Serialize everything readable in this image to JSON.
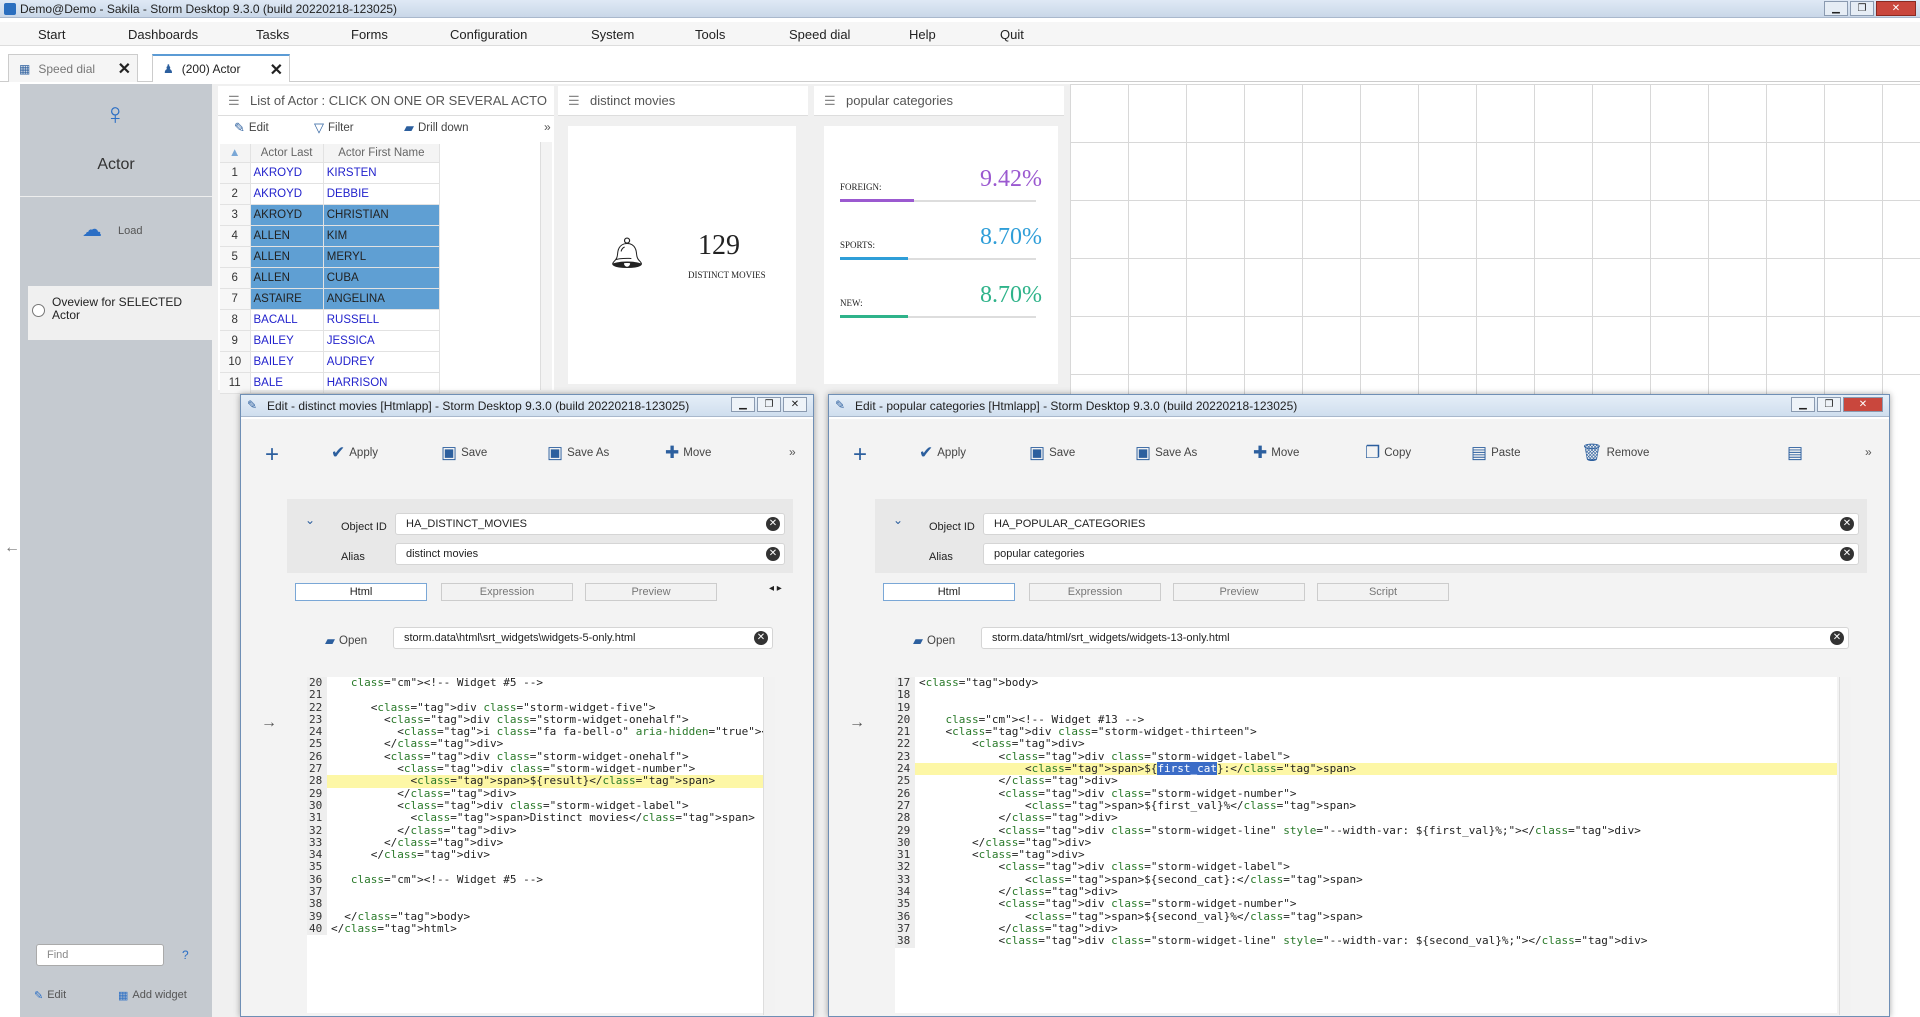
{
  "window": {
    "title": "Demo@Demo - Sakila -  Storm Desktop 9.3.0 (build 20220218-123025)"
  },
  "menu": [
    "Start",
    "Dashboards",
    "Tasks",
    "Forms",
    "Configuration",
    "System",
    "Tools",
    "Speed dial",
    "Help",
    "Quit"
  ],
  "tabs": [
    {
      "label": "Speed dial"
    },
    {
      "label": "(200) Actor"
    }
  ],
  "sidebar": {
    "title": "Actor",
    "load": "Load",
    "overview": "Oveview for SELECTED Actor",
    "find_placeholder": "Find",
    "help": "?",
    "edit": "Edit",
    "add_widget": "Add widget"
  },
  "list_panel": {
    "title": "List of Actor : CLICK ON ONE OR SEVERAL ACTO",
    "edit": "Edit",
    "filter": "Filter",
    "drill": "Drill down",
    "more": "»",
    "columns": [
      "Actor Last",
      "Actor First Name"
    ],
    "rows": [
      [
        "1",
        "AKROYD",
        "KIRSTEN",
        false
      ],
      [
        "2",
        "AKROYD",
        "DEBBIE",
        false
      ],
      [
        "3",
        "AKROYD",
        "CHRISTIAN",
        true
      ],
      [
        "4",
        "ALLEN",
        "KIM",
        true
      ],
      [
        "5",
        "ALLEN",
        "MERYL",
        true
      ],
      [
        "6",
        "ALLEN",
        "CUBA",
        true
      ],
      [
        "7",
        "ASTAIRE",
        "ANGELINA",
        true
      ],
      [
        "8",
        "BACALL",
        "RUSSELL",
        false
      ],
      [
        "9",
        "BAILEY",
        "JESSICA",
        false
      ],
      [
        "10",
        "BAILEY",
        "AUDREY",
        false
      ],
      [
        "11",
        "BALE",
        "HARRISON",
        false
      ]
    ]
  },
  "distinct_panel": {
    "title": "distinct movies",
    "number": "129",
    "label": "DISTINCT MOVIES"
  },
  "popular_panel": {
    "title": "popular categories",
    "items": [
      {
        "name": "FOREIGN:",
        "val": "9.42%",
        "pct": 9.42,
        "color": "#9b59d0"
      },
      {
        "name": "SPORTS:",
        "val": "8.70%",
        "pct": 8.7,
        "color": "#2f9ed8"
      },
      {
        "name": "NEW:",
        "val": "8.70%",
        "pct": 8.7,
        "color": "#2fb38a"
      }
    ]
  },
  "edit1": {
    "title": "Edit - distinct movies [Htmlapp] -  Storm Desktop 9.3.0 (build 20220218-123025)",
    "buttons": [
      "Apply",
      "Save",
      "Save As",
      "Move"
    ],
    "more": "»",
    "object_id_label": "Object ID",
    "object_id": "HA_DISTINCT_MOVIES",
    "alias_label": "Alias",
    "alias": "distinct movies",
    "subtabs": [
      "Html",
      "Expression",
      "Preview"
    ],
    "open": "Open",
    "file": "storm.data\\html\\srt_widgets\\widgets-5-only.html"
  },
  "edit2": {
    "title": "Edit - popular categories [Htmlapp] -  Storm Desktop 9.3.0 (build 20220218-123025)",
    "buttons": [
      "Apply",
      "Save",
      "Save As",
      "Move",
      "Copy",
      "Paste",
      "Remove"
    ],
    "more": "»",
    "object_id_label": "Object ID",
    "object_id": "HA_POPULAR_CATEGORIES",
    "alias_label": "Alias",
    "alias": "popular categories",
    "subtabs": [
      "Html",
      "Expression",
      "Preview",
      "Script"
    ],
    "open": "Open",
    "file": "storm.data/html/srt_widgets/widgets-13-only.html"
  },
  "code1": [
    [
      "20",
      "   <!-- Widget #5 -->"
    ],
    [
      "21",
      ""
    ],
    [
      "22",
      "      <div class=\"storm-widget-five\">"
    ],
    [
      "23",
      "        <div class=\"storm-widget-onehalf\">"
    ],
    [
      "24",
      "          <i class=\"fa fa-bell-o\" aria-hidden=\"true\"></i>"
    ],
    [
      "25",
      "        </div>"
    ],
    [
      "26",
      "        <div class=\"storm-widget-onehalf\">"
    ],
    [
      "27",
      "          <div class=\"storm-widget-number\">"
    ],
    [
      "28",
      "            <span>${result}</span>"
    ],
    [
      "29",
      "          </div>"
    ],
    [
      "30",
      "          <div class=\"storm-widget-label\">"
    ],
    [
      "31",
      "            <span>Distinct movies</span>"
    ],
    [
      "32",
      "          </div>"
    ],
    [
      "33",
      "        </div>"
    ],
    [
      "34",
      "      </div>"
    ],
    [
      "35",
      ""
    ],
    [
      "36",
      "   <!-- Widget #5 -->"
    ],
    [
      "37",
      ""
    ],
    [
      "38",
      ""
    ],
    [
      "39",
      "  </body>"
    ],
    [
      "40",
      "</html>"
    ]
  ],
  "code2": [
    [
      "17",
      "<body>"
    ],
    [
      "18",
      ""
    ],
    [
      "19",
      ""
    ],
    [
      "20",
      "    <!-- Widget #13 -->"
    ],
    [
      "21",
      "    <div class=\"storm-widget-thirteen\">"
    ],
    [
      "22",
      "        <div>"
    ],
    [
      "23",
      "            <div class=\"storm-widget-label\">"
    ],
    [
      "24",
      "                <span>${first_cat}:</span>"
    ],
    [
      "25",
      "            </div>"
    ],
    [
      "26",
      "            <div class=\"storm-widget-number\">"
    ],
    [
      "27",
      "                <span>${first_val}%</span>"
    ],
    [
      "28",
      "            </div>"
    ],
    [
      "29",
      "            <div class=\"storm-widget-line\" style=\"--width-var: ${first_val}%;\"></div>"
    ],
    [
      "30",
      "        </div>"
    ],
    [
      "31",
      "        <div>"
    ],
    [
      "32",
      "            <div class=\"storm-widget-label\">"
    ],
    [
      "33",
      "                <span>${second_cat}:</span>"
    ],
    [
      "34",
      "            </div>"
    ],
    [
      "35",
      "            <div class=\"storm-widget-number\">"
    ],
    [
      "36",
      "                <span>${second_val}%</span>"
    ],
    [
      "37",
      "            </div>"
    ],
    [
      "38",
      "            <div class=\"storm-widget-line\" style=\"--width-var: ${second_val}%;\"></div>"
    ]
  ]
}
